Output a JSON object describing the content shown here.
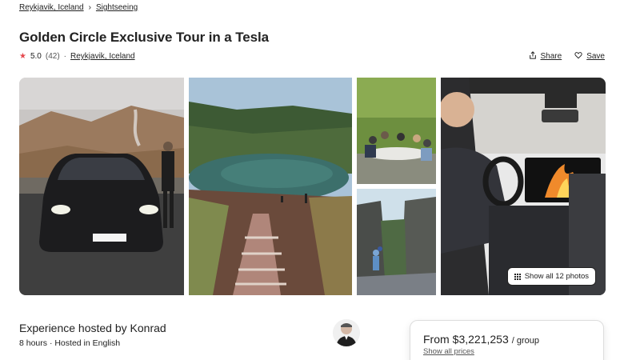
{
  "breadcrumb": {
    "items": [
      "Reykjavik, Iceland",
      "Sightseeing"
    ],
    "separator": "›"
  },
  "listing": {
    "title": "Golden Circle Exclusive Tour in a Tesla",
    "rating": "5.0",
    "reviews": "(42)",
    "location": "Reykjavik, Iceland"
  },
  "actions": {
    "share": "Share",
    "save": "Save"
  },
  "gallery": {
    "show_all_label": "Show all 12 photos",
    "photos": [
      "Tesla with driver in volcanic landscape",
      "Crater lake with stairs",
      "Group dining outdoors",
      "Hikers in rocky canyon",
      "Driver inside Tesla with fireplace screen"
    ]
  },
  "host": {
    "title": "Experience hosted by Konrad",
    "subtitle": "8 hours · Hosted in English"
  },
  "pricing": {
    "from_label": "From",
    "amount": "$3,221,253",
    "unit": "/ group",
    "show_prices": "Show all prices"
  },
  "colors": {
    "star": "#e5484d",
    "text": "#222222",
    "border": "#dddddd"
  }
}
